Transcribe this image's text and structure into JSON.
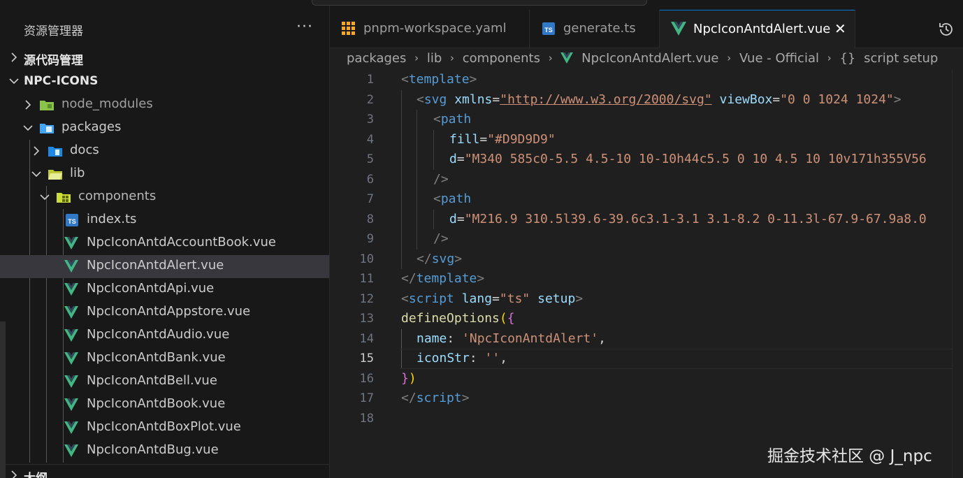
{
  "explorer": {
    "title": "资源管理器",
    "more": "···",
    "source_control": "源代码管理",
    "workspace": "NPC-ICONS",
    "outline": "大纲",
    "tree": [
      {
        "label": "node_modules"
      },
      {
        "label": "packages"
      },
      {
        "label": "docs"
      },
      {
        "label": "lib"
      },
      {
        "label": "components"
      },
      {
        "label": "index.ts"
      },
      {
        "label": "NpcIconAntdAccountBook.vue"
      },
      {
        "label": "NpcIconAntdAlert.vue"
      },
      {
        "label": "NpcIconAntdApi.vue"
      },
      {
        "label": "NpcIconAntdAppstore.vue"
      },
      {
        "label": "NpcIconAntdAudio.vue"
      },
      {
        "label": "NpcIconAntdBank.vue"
      },
      {
        "label": "NpcIconAntdBell.vue"
      },
      {
        "label": "NpcIconAntdBook.vue"
      },
      {
        "label": "NpcIconAntdBoxPlot.vue"
      },
      {
        "label": "NpcIconAntdBug.vue"
      }
    ]
  },
  "tabs": [
    {
      "label": "pnpm-workspace.yaml",
      "icon": "yaml-grid-icon"
    },
    {
      "label": "generate.ts",
      "icon": "typescript-icon"
    },
    {
      "label": "NpcIconAntdAlert.vue",
      "icon": "vue-icon",
      "close": "✕"
    }
  ],
  "breadcrumb": {
    "items": [
      "packages",
      "lib",
      "components",
      "NpcIconAntdAlert.vue",
      "Vue - Official",
      "script setup"
    ],
    "sep": "›",
    "braces": "{}"
  },
  "code": {
    "line_numbers": [
      "1",
      "2",
      "3",
      "4",
      "5",
      "6",
      "7",
      "8",
      "9",
      "10",
      "11",
      "12",
      "13",
      "14",
      "15",
      "16",
      "17",
      "18"
    ],
    "current_line": "15",
    "t": {
      "lt": "<",
      "gt": ">",
      "lts": "</",
      "sgt": "/>",
      "eq": "=",
      "template": "template",
      "svg": "svg",
      "path": "path",
      "script": "script",
      "xmlns": "xmlns",
      "xmlns_val": "\"http://www.w3.org/2000/svg\"",
      "viewbox": "viewBox",
      "viewbox_val": "\"0 0 1024 1024\"",
      "fill": "fill",
      "fill_val": "\"#D9D9D9\"",
      "d": "d",
      "d1_val": "\"M340 585c0-5.5 4.5-10 10-10h44c5.5 0 10 4.5 10 10v171h355V56",
      "d2_val": "\"M216.9 310.5l39.6-39.6c3.1-3.1 3.1-8.2 0-11.3l-67.9-67.9a8.0",
      "lang": "lang",
      "lang_val": "\"ts\"",
      "setup": "setup",
      "define": "defineOptions",
      "lparen": "(",
      "rparen": ")",
      "lbrace": "{",
      "rbrace": "}",
      "name_key": "name",
      "name_val": "'NpcIconAntdAlert'",
      "iconstr_key": "iconStr",
      "iconstr_val": "''",
      "colon": ": ",
      "comma": ","
    }
  },
  "watermark": "掘金技术社区 @ J_npc"
}
